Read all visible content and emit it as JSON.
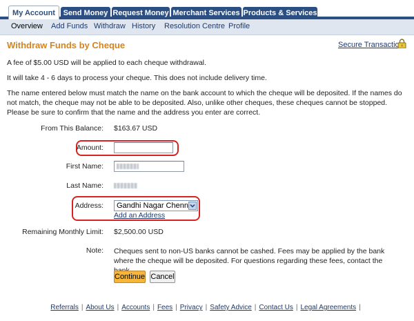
{
  "tabs": [
    {
      "label": "My Account"
    },
    {
      "label": "Send Money"
    },
    {
      "label": "Request Money"
    },
    {
      "label": "Merchant Services"
    },
    {
      "label": "Products & Services"
    }
  ],
  "subnav": [
    {
      "label": "Overview"
    },
    {
      "label": "Add Funds"
    },
    {
      "label": "Withdraw"
    },
    {
      "label": "History"
    },
    {
      "label": "Resolution Centre"
    },
    {
      "label": "Profile"
    }
  ],
  "page": {
    "title": "Withdraw Funds by Cheque",
    "secure_link": "Secure Transaction",
    "fee_text": "A fee of $5.00 USD will be applied to each cheque withdrawal.",
    "time_text": "It will take 4 - 6 days to process your cheque. This does not include delivery time.",
    "name_notice": "The name entered below must match the name on the bank account to which the cheque will be deposited. If the names do not match, the cheque may not be able to be deposited. Also, unlike other cheques, these cheques cannot be stopped. Please be sure to confirm that the name and the address you enter are correct."
  },
  "form": {
    "balance_label": "From This Balance:",
    "balance_value": "$163.67 USD",
    "amount_label": "Amount:",
    "amount_value": "",
    "first_name_label": "First Name:",
    "last_name_label": "Last Name:",
    "address_label": "Address:",
    "address_selected": "Gandhi Nagar Chennai,",
    "add_address_link": "Add an Address",
    "remaining_label": "Remaining Monthly Limit:",
    "remaining_value": "$2,500.00 USD",
    "note_label": "Note:",
    "note_text": "Cheques sent to non-US banks cannot be cashed. Fees may be applied by the bank where the cheque will be deposited. For questions regarding these fees, contact the bank.",
    "continue_label": "Continue",
    "cancel_label": "Cancel"
  },
  "footer": [
    {
      "label": "Referrals"
    },
    {
      "label": "About Us"
    },
    {
      "label": "Accounts"
    },
    {
      "label": "Fees"
    },
    {
      "label": "Privacy"
    },
    {
      "label": "Safety Advice"
    },
    {
      "label": "Contact Us"
    },
    {
      "label": "Legal Agreements"
    }
  ],
  "colors": {
    "accent": "#d7831c",
    "nav": "#2b4f82",
    "highlight": "#d7221f",
    "button": "#f5b63a"
  }
}
